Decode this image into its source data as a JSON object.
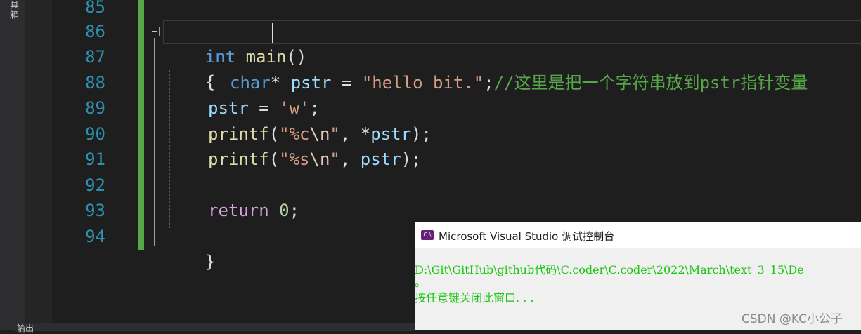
{
  "toolbox": {
    "label": "具箱"
  },
  "editor": {
    "line_numbers": [
      "85",
      "86",
      "87",
      "88",
      "89",
      "90",
      "91",
      "92",
      "93",
      "94"
    ],
    "code": {
      "l86": {
        "kw": "int",
        "fn": "main",
        "rest": "()"
      },
      "l87": {
        "brace": "{"
      },
      "l88": {
        "kw": "char",
        "star": "* ",
        "id": "pstr",
        "eq": " = ",
        "str": "\"hello bit.\"",
        "semi": ";",
        "comment": "//这里是把一个字符串放到pstr指针变量"
      },
      "l89": {
        "id": "pstr",
        "eq": " = ",
        "str": "'w'",
        "semi": ";"
      },
      "l90": {
        "fn": "printf",
        "open": "(",
        "str1": "\"%c",
        "esc": "\\n",
        "str2": "\"",
        "mid": ", *",
        "id": "pstr",
        "close": ");"
      },
      "l91": {
        "fn": "printf",
        "open": "(",
        "str1": "\"%s",
        "esc": "\\n",
        "str2": "\"",
        "mid": ", ",
        "id": "pstr",
        "close": ");"
      },
      "l93": {
        "kw": "return",
        "sp": " ",
        "num": "0",
        "semi": ";"
      },
      "l94": {
        "brace": "}"
      }
    },
    "colors": {
      "keyword": "#569cd6",
      "identifier": "#9cdcfe",
      "string": "#d69d85",
      "comment": "#57a64a",
      "line_number": "#2b91af"
    }
  },
  "bottom_panel": {
    "tab_label": "输出"
  },
  "console": {
    "title": "Microsoft Visual Studio 调试控制台",
    "icon_text": "C:\\",
    "lines": [
      "D:\\Git\\GitHub\\github代码\\C.coder\\C.coder\\2022\\March\\text_3_15\\De",
      "。",
      "按任意键关闭此窗口. . ."
    ]
  },
  "watermark": "CSDN @KC小公子"
}
